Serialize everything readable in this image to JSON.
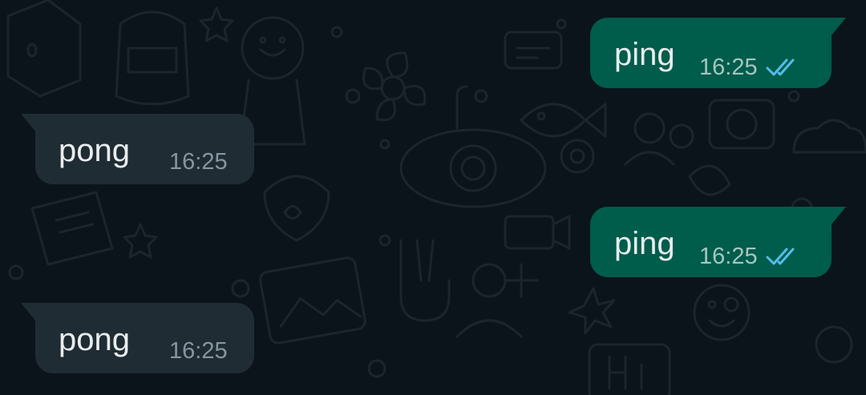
{
  "colors": {
    "background": "#0b141a",
    "outgoing_bubble": "#005c4b",
    "incoming_bubble": "#202c33",
    "message_text": "#e9edef",
    "read_ticks": "#53bdeb"
  },
  "messages": [
    {
      "direction": "outgoing",
      "text": "ping",
      "time": "16:25",
      "status": "read",
      "status_icon": "double-check-icon"
    },
    {
      "direction": "incoming",
      "text": "pong",
      "time": "16:25"
    },
    {
      "direction": "outgoing",
      "text": "ping",
      "time": "16:25",
      "status": "read",
      "status_icon": "double-check-icon"
    },
    {
      "direction": "incoming",
      "text": "pong",
      "time": "16:25"
    }
  ]
}
